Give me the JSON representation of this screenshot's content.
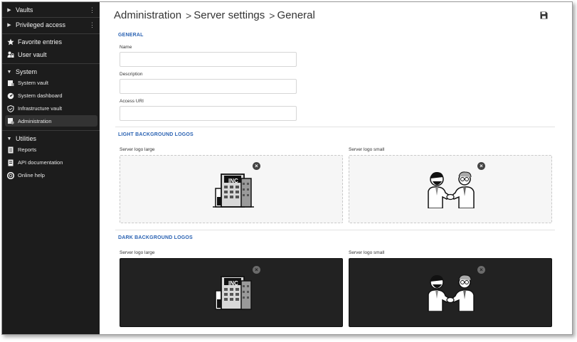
{
  "sidebar": {
    "groups": [
      {
        "label": "Vaults"
      },
      {
        "label": "Privileged access"
      }
    ],
    "top_items": [
      {
        "label": "Favorite entries",
        "icon": "star-icon"
      },
      {
        "label": "User vault",
        "icon": "user-lock-icon"
      }
    ],
    "system": {
      "label": "System",
      "items": [
        {
          "label": "System vault",
          "icon": "vault-icon"
        },
        {
          "label": "System dashboard",
          "icon": "dashboard-icon"
        },
        {
          "label": "Infrastructure vault",
          "icon": "shield-icon"
        },
        {
          "label": "Administration",
          "icon": "admin-icon",
          "active": true
        }
      ]
    },
    "utilities": {
      "label": "Utilities",
      "items": [
        {
          "label": "Reports",
          "icon": "report-icon"
        },
        {
          "label": "API documentation",
          "icon": "api-doc-icon"
        },
        {
          "label": "Online help",
          "icon": "help-icon"
        }
      ]
    }
  },
  "breadcrumb": [
    "Administration",
    "Server settings",
    "General"
  ],
  "breadcrumb_separator": ">",
  "general": {
    "title": "GENERAL",
    "fields": [
      {
        "label": "Name",
        "value": ""
      },
      {
        "label": "Description",
        "value": ""
      },
      {
        "label": "Access URI",
        "value": ""
      }
    ]
  },
  "light_logos": {
    "title": "LIGHT BACKGROUND LOGOS",
    "large_label": "Server logo large",
    "small_label": "Server logo small",
    "building_sign": "INC"
  },
  "dark_logos": {
    "title": "DARK BACKGROUND LOGOS",
    "large_label": "Server logo large",
    "small_label": "Server logo small",
    "building_sign": "INC"
  },
  "colors": {
    "sidebar_bg": "#1c1c1c",
    "section_title": "#2b63b3",
    "dark_logo_bg": "#222222"
  }
}
